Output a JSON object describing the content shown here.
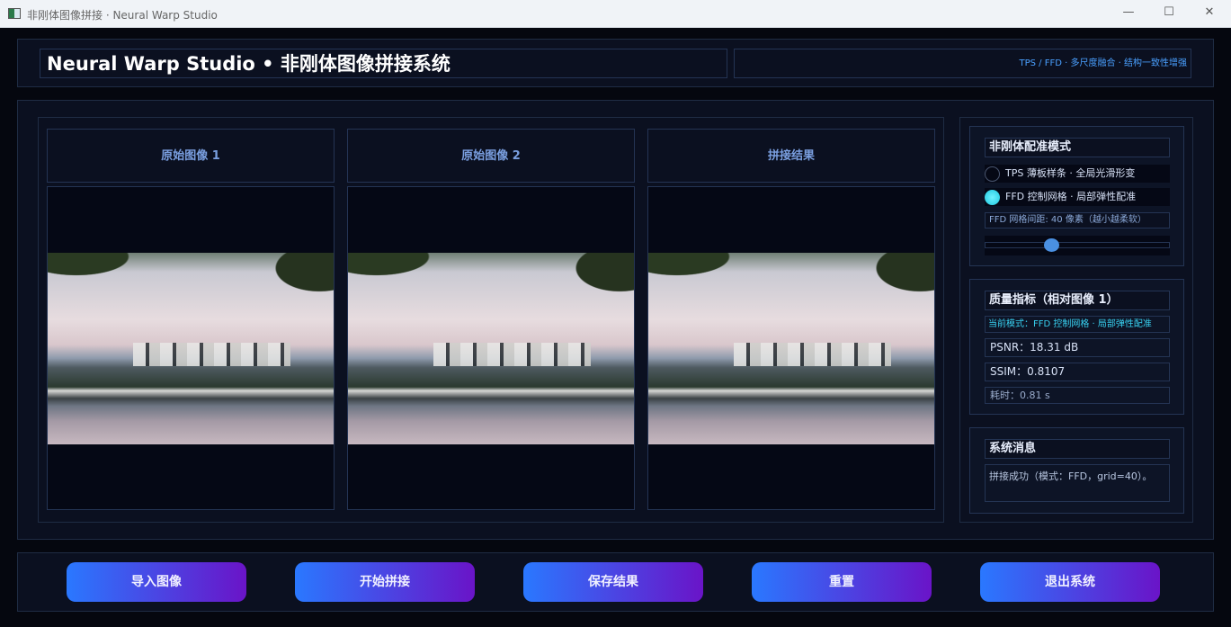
{
  "window": {
    "title": "非刚体图像拼接 · Neural Warp Studio",
    "controls": [
      "minimize",
      "maximize",
      "close"
    ]
  },
  "header": {
    "title": "Neural Warp Studio • 非刚体图像拼接系统",
    "subtitle": "TPS / FFD · 多尺度融合 · 结构一致性增强"
  },
  "panels": [
    {
      "label": "原始图像 1"
    },
    {
      "label": "原始图像 2"
    },
    {
      "label": "拼接结果"
    }
  ],
  "mode": {
    "title": "非刚体配准模式",
    "options": [
      {
        "label": "TPS 薄板样条 · 全局光滑形变",
        "selected": false
      },
      {
        "label": "FFD 控制网格 · 局部弹性配准",
        "selected": true
      }
    ],
    "grid_label": "FFD 网格间距: 40 像素（越小越柔软）",
    "slider_fraction": 0.35
  },
  "metrics": {
    "title": "质量指标（相对图像 1）",
    "current_mode": "当前模式：FFD 控制网格 · 局部弹性配准",
    "psnr": "PSNR：18.31 dB",
    "ssim": "SSIM：0.8107",
    "time": "耗时：0.81 s"
  },
  "messages": {
    "title": "系统消息",
    "text": "拼接成功（模式：FFD，grid=40）。"
  },
  "buttons": {
    "import": "导入图像",
    "stitch": "开始拼接",
    "save": "保存结果",
    "reset": "重置",
    "exit": "退出系统"
  },
  "colors": {
    "accent": "#4aa0ff",
    "radio_active": "#2ee0f0",
    "button_start": "#2a78ff",
    "button_end": "#6a14c8"
  }
}
